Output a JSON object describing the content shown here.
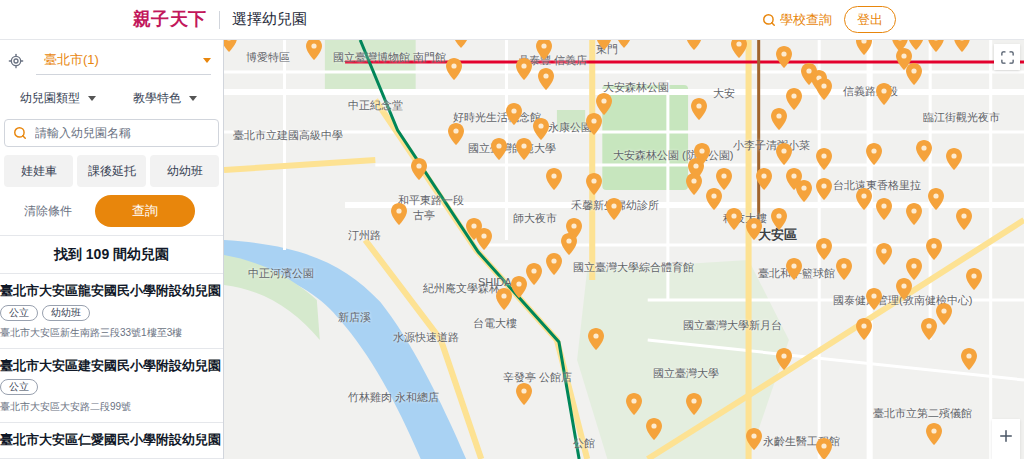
{
  "header": {
    "logo": "親子天下",
    "title": "選擇幼兒園",
    "search_link": "學校查詢",
    "logout": "登出"
  },
  "sidebar": {
    "city": "臺北市(1)",
    "filters": [
      {
        "label": "幼兒園類型"
      },
      {
        "label": "教學特色"
      }
    ],
    "search": {
      "placeholder": "請輸入幼兒園名稱"
    },
    "toggles": [
      {
        "label": "娃娃車",
        "selected": false
      },
      {
        "label": "課後延托",
        "selected": false
      },
      {
        "label": "幼幼班",
        "selected": false
      }
    ],
    "clear": "清除條件",
    "submit": "查詢",
    "result_count": "找到 109 間幼兒園",
    "results": [
      {
        "name": "臺北市大安區龍安國民小學附設幼兒園",
        "tags": [
          "公立",
          "幼幼班"
        ],
        "address": "臺北市大安區新生南路三段33號1樓至3樓"
      },
      {
        "name": "臺北市大安區建安國民小學附設幼兒園",
        "tags": [
          "公立"
        ],
        "address": "臺北市大安區大安路二段99號"
      },
      {
        "name": "臺北市大安區仁愛國民小學附設幼兒園",
        "tags": [],
        "address": ""
      }
    ]
  },
  "map": {
    "labels": [
      "博愛特區",
      "國立臺灣博物館 南門館",
      "東門",
      "中正紀念堂",
      "鼎泰豐 信義店",
      "大安森林公園",
      "大安",
      "信義路三段",
      "臺北市立建國高級中學",
      "好時光生活概念館",
      "永康公園",
      "臨江街觀光夜市",
      "小李子清粥小菜",
      "大安森林公園 (防災公園)",
      "國立臺灣師範大學",
      "台北遠東香格里拉",
      "和平東路一段",
      "禾馨新生婦幼診所",
      "古亭",
      "師大夜市",
      "科技大樓",
      "大安區",
      "汀州路",
      "中正河濱公園",
      "紀州庵文學森林",
      "SHIDA",
      "國立臺灣大學綜合體育館",
      "臺北和平籃球館",
      "國泰健康管理(敦南健檢中心)",
      "新店溪",
      "水源快速道路",
      "台電大樓",
      "國立臺灣大學新月台",
      "國立臺灣大學",
      "辛發亭 公館店",
      "竹林雞肉 永和總店",
      "臺北市立第二殯儀館",
      "永齡生醫工程館",
      "公館"
    ]
  }
}
